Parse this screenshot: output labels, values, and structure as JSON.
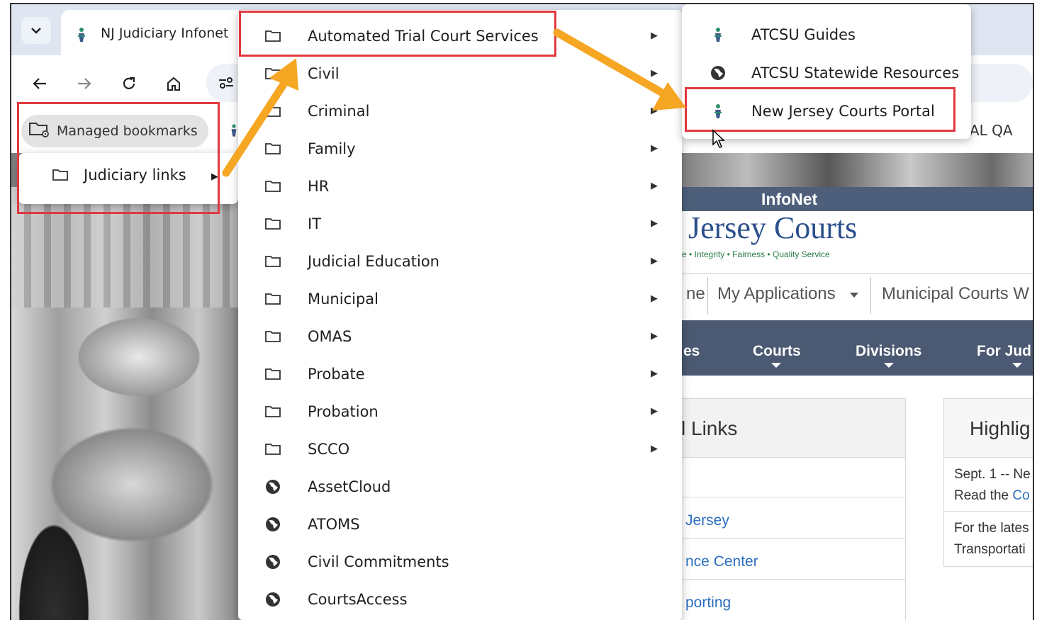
{
  "browser": {
    "tab_title": "NJ Judiciary Infonet",
    "bookmarks_bar": {
      "managed_label": "Managed bookmarks",
      "right_partial_label": "AL QA"
    }
  },
  "managed_menu": {
    "items": [
      {
        "label": "Judiciary links",
        "icon": "folder-icon",
        "has_submenu": true
      }
    ]
  },
  "judiciary_links_menu": {
    "items": [
      {
        "label": "Automated Trial Court Services",
        "icon": "folder-icon",
        "has_submenu": true
      },
      {
        "label": "Civil",
        "icon": "folder-icon",
        "has_submenu": true
      },
      {
        "label": "Criminal",
        "icon": "folder-icon",
        "has_submenu": true
      },
      {
        "label": "Family",
        "icon": "folder-icon",
        "has_submenu": true
      },
      {
        "label": "HR",
        "icon": "folder-icon",
        "has_submenu": true
      },
      {
        "label": "IT",
        "icon": "folder-icon",
        "has_submenu": true
      },
      {
        "label": "Judicial Education",
        "icon": "folder-icon",
        "has_submenu": true
      },
      {
        "label": "Municipal",
        "icon": "folder-icon",
        "has_submenu": true
      },
      {
        "label": "OMAS",
        "icon": "folder-icon",
        "has_submenu": true
      },
      {
        "label": "Probate",
        "icon": "folder-icon",
        "has_submenu": true
      },
      {
        "label": "Probation",
        "icon": "folder-icon",
        "has_submenu": true
      },
      {
        "label": "SCCO",
        "icon": "folder-icon",
        "has_submenu": true
      },
      {
        "label": "AssetCloud",
        "icon": "globe-icon",
        "has_submenu": false
      },
      {
        "label": "ATOMS",
        "icon": "globe-icon",
        "has_submenu": false
      },
      {
        "label": "Civil Commitments",
        "icon": "globe-icon",
        "has_submenu": false
      },
      {
        "label": "CourtsAccess",
        "icon": "globe-icon",
        "has_submenu": false
      }
    ]
  },
  "atcs_menu": {
    "items": [
      {
        "label": "ATCSU Guides",
        "icon": "nj-courts-favicon-icon"
      },
      {
        "label": "ATCSU Statewide Resources",
        "icon": "globe-icon"
      },
      {
        "label": "New Jersey Courts Portal",
        "icon": "nj-courts-favicon-icon"
      }
    ]
  },
  "page": {
    "header_bar": "InfoNet",
    "site_title": "Jersey Courts",
    "tagline": "ce • Integrity • Fairness • Quality Service",
    "top_nav": [
      "ne",
      "My Applications",
      "Municipal Courts W"
    ],
    "main_nav": [
      "es",
      "Courts",
      "Divisions",
      "For Jud"
    ],
    "links_panel": {
      "title": "l Links",
      "links": [
        "Jersey",
        "nce Center",
        "porting"
      ]
    },
    "highlights_panel": {
      "title": "Highlig",
      "line1": "Sept. 1 -- Ne",
      "line2_prefix": "Read the ",
      "line2_link": "Co",
      "line3": "For the lates",
      "line4": "Transportati"
    }
  },
  "colors": {
    "annotation_red": "#e0383e",
    "annotation_arrow": "#f5a623",
    "infonet_bar": "#4d5f7a",
    "nav_bar": "#4b5a72",
    "link_blue": "#2a6ebf"
  }
}
